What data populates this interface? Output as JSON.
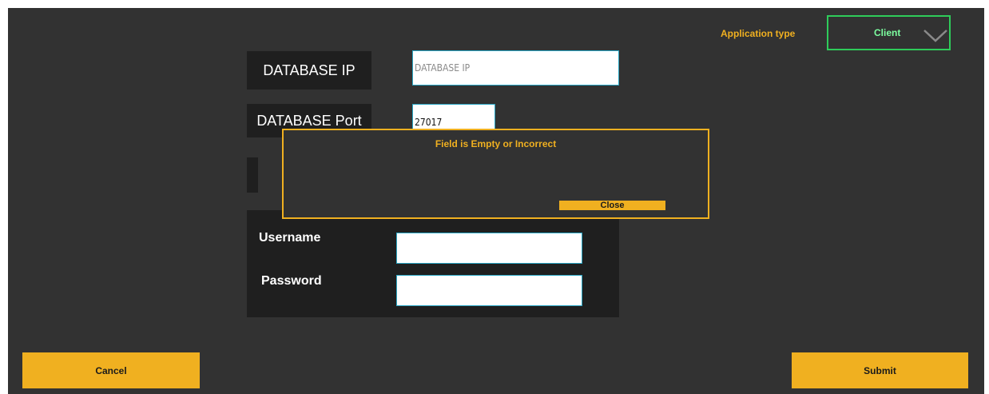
{
  "header": {
    "app_type_label": "Application type",
    "app_type_value": "Client",
    "app_type_chevron": "chevron-down-icon"
  },
  "form": {
    "db_ip_label": "DATABASE IP",
    "db_ip_placeholder": "DATABASE IP",
    "db_port_label": "DATABASE Port",
    "db_port_value": "27017",
    "username_label": "Username",
    "password_label": "Password"
  },
  "dialog": {
    "message": "Field is Empty or Incorrect",
    "close_label": "Close"
  },
  "footer": {
    "cancel_label": "Cancel",
    "submit_label": "Submit"
  },
  "colors": {
    "background": "#323232",
    "panel": "#1f1f1f",
    "accent": "#f0b020",
    "select_border": "#2ecc5a",
    "input_border": "#2aa6c4"
  }
}
